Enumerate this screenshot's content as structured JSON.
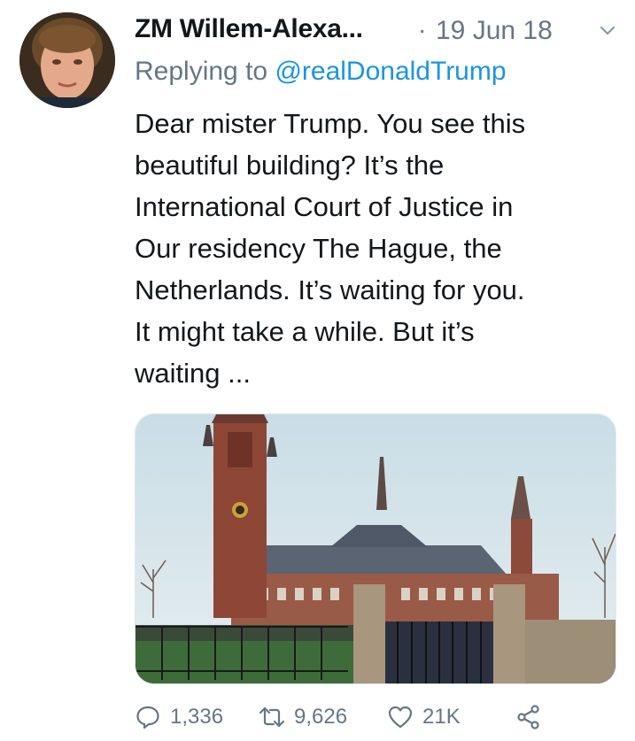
{
  "tweet": {
    "author_name": "ZM Willem-Alexa...",
    "separator": "·",
    "date": "19 Jun 18",
    "replying_prefix": "Replying to ",
    "replying_handle": "@realDonaldTrump",
    "text_lines": [
      "Dear mister Trump. You see this",
      "beautiful building? It’s the",
      "International Court of Justice in",
      "Our residency The Hague, the",
      "Netherlands. It’s waiting for you.",
      "It might take a while. But it’s",
      "waiting ..."
    ]
  },
  "actions": {
    "reply_count": "1,336",
    "retweet_count": "9,626",
    "like_count": "21K"
  },
  "icons": {
    "reply": "reply-icon",
    "retweet": "retweet-icon",
    "like": "heart-icon",
    "share": "share-icon",
    "menu": "chevron-down-icon"
  },
  "colors": {
    "link": "#1b95e0",
    "muted": "#657786",
    "text": "#14171a"
  }
}
